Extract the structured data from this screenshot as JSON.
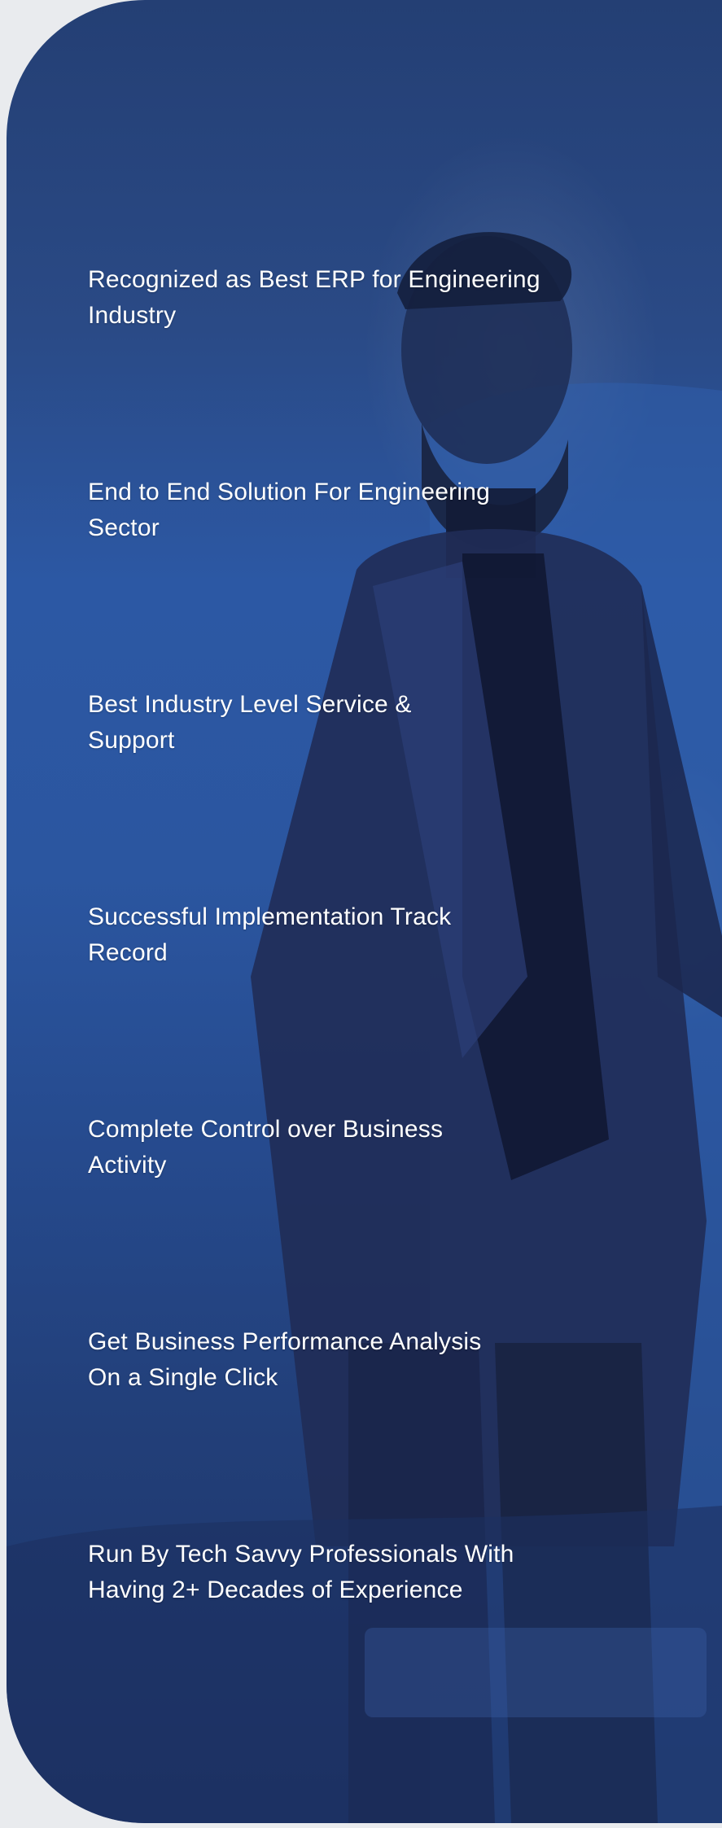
{
  "features": [
    {
      "line1": "Recognized as Best ERP for Engineering",
      "line2": "Industry"
    },
    {
      "line1": "End to End Solution For Engineering",
      "line2": "Sector"
    },
    {
      "line1": "Best Industry Level Service &",
      "line2": "Support"
    },
    {
      "line1": "Successful Implementation Track",
      "line2": "Record"
    },
    {
      "line1": "Complete Control over Business",
      "line2": "Activity"
    },
    {
      "line1": "Get Business Performance Analysis",
      "line2": "On a Single Click"
    },
    {
      "line1": "Run By Tech Savvy Professionals With",
      "line2": "Having 2+ Decades of Experience"
    }
  ],
  "colors": {
    "panel_top": "#243f74",
    "panel_mid": "#2c58a4",
    "panel_bottom": "#1d3366",
    "text": "#ffffff",
    "page_background": "#e9ebee"
  },
  "background_image": "businessman-presenting-photo"
}
